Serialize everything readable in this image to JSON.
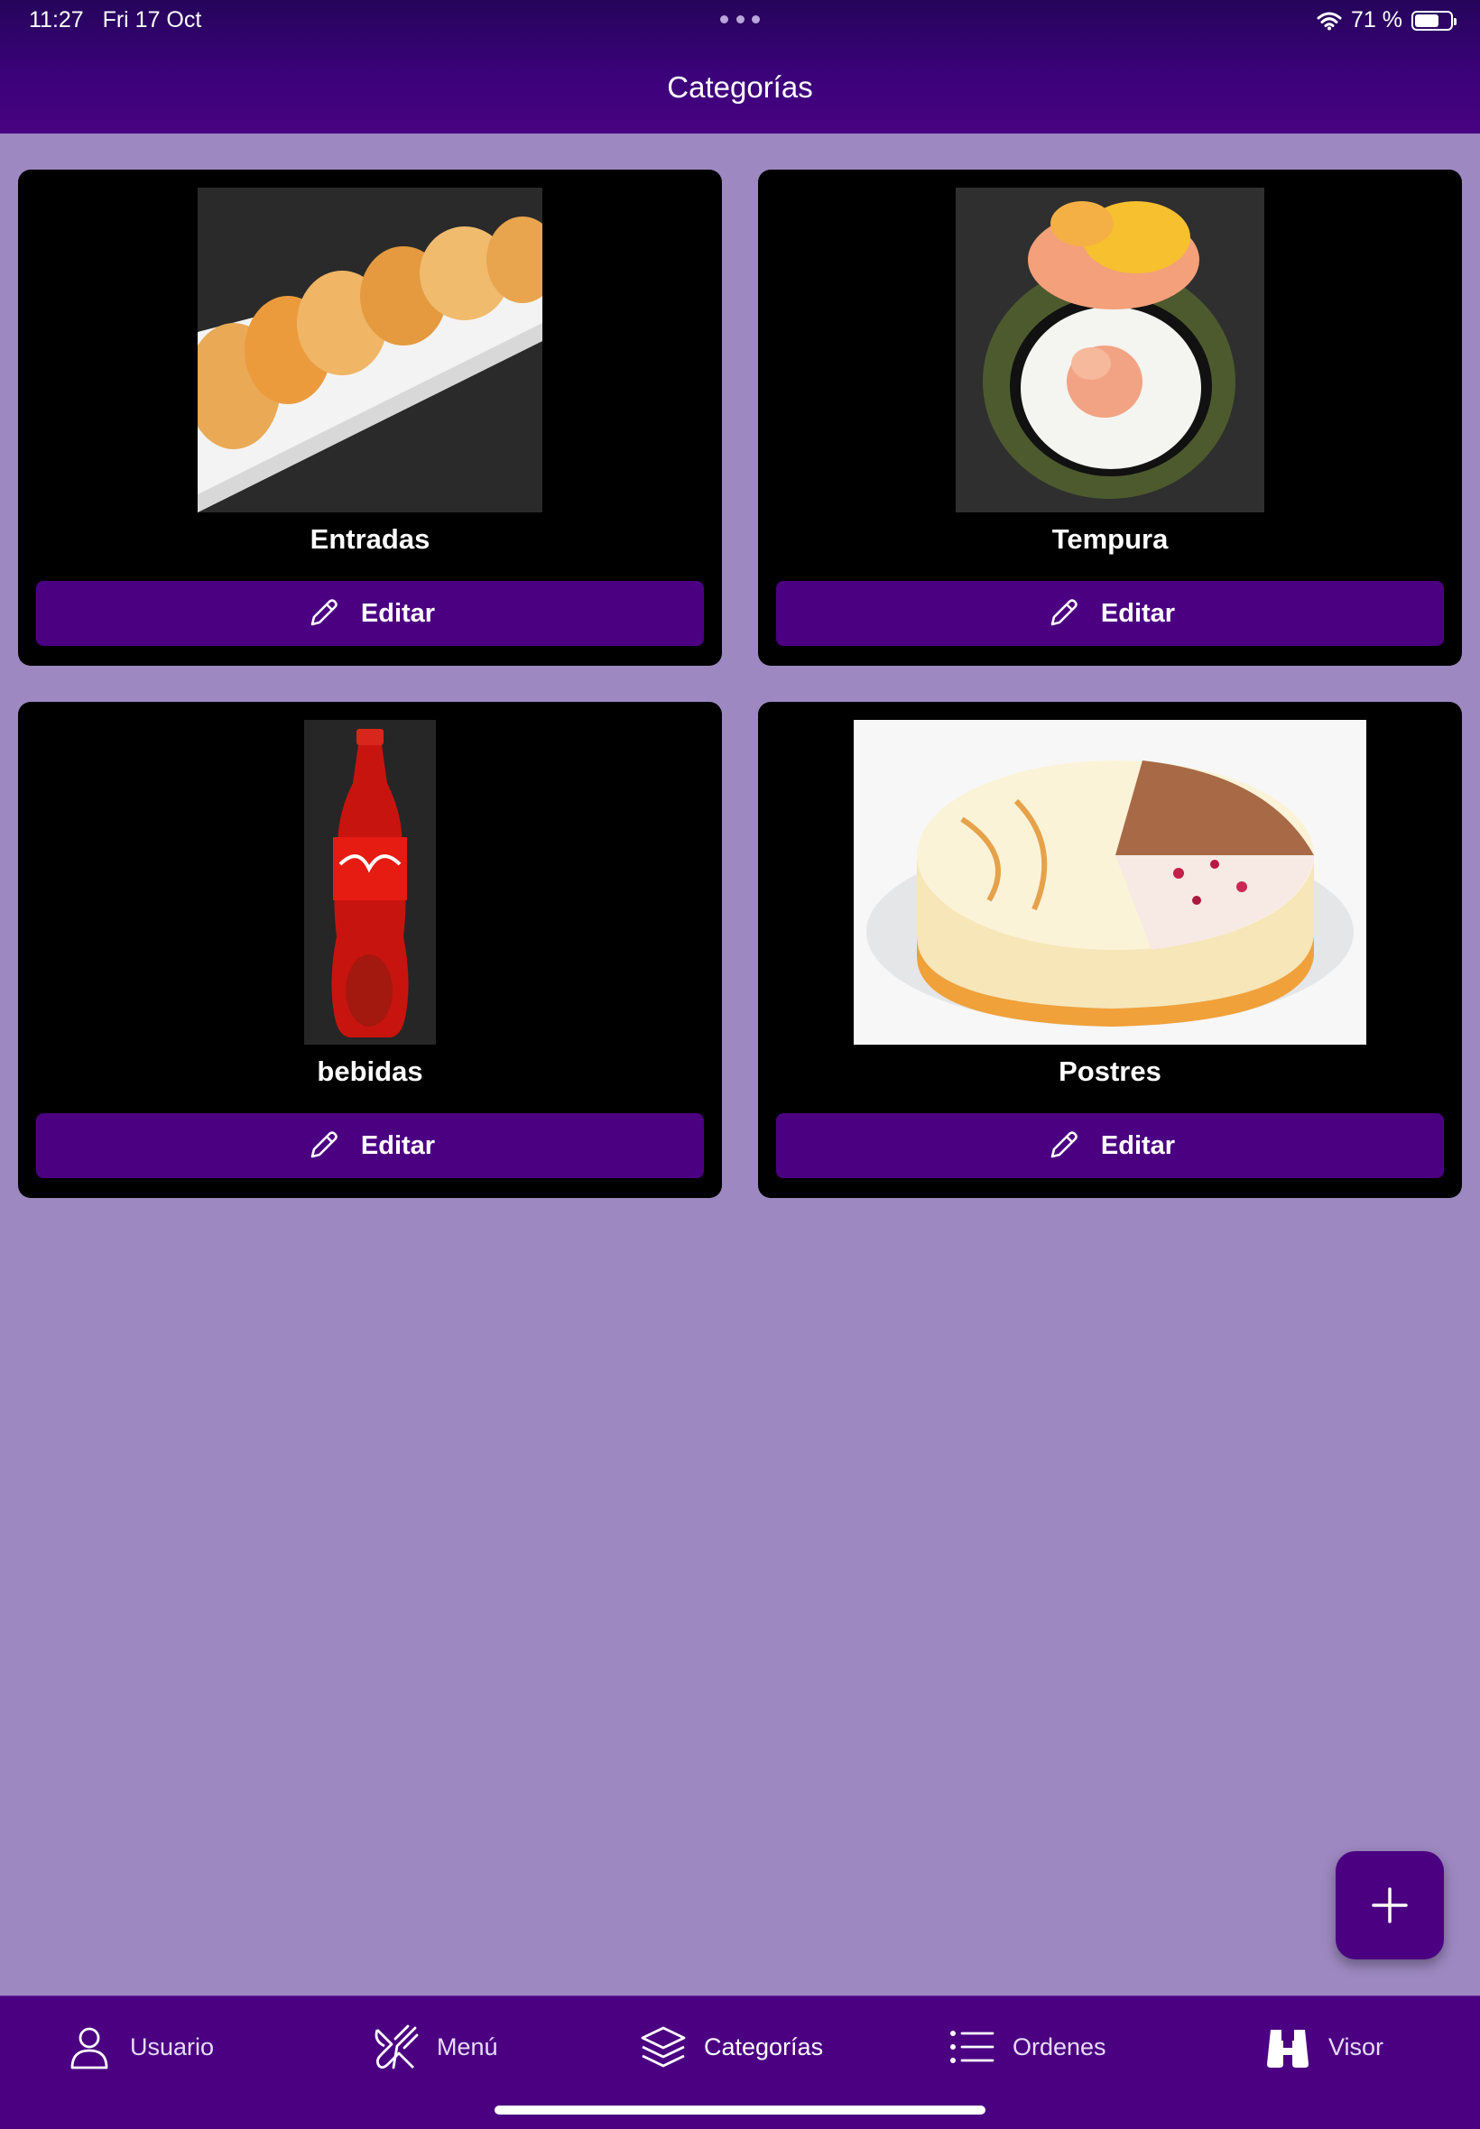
{
  "status_bar": {
    "time": "11:27",
    "date": "Fri 17 Oct",
    "battery": "71 %",
    "battery_level": 0.71,
    "icons": [
      "wifi-icon",
      "battery-icon",
      "more-dots-icon"
    ]
  },
  "header": {
    "title": "Categorías"
  },
  "categories": [
    {
      "name": "Entradas",
      "edit_label": "Editar",
      "image": "dumplings-photo"
    },
    {
      "name": "Tempura",
      "edit_label": "Editar",
      "image": "tempura-roll-photo"
    },
    {
      "name": "bebidas",
      "edit_label": "Editar",
      "image": "cola-bottle-photo"
    },
    {
      "name": "Postres",
      "edit_label": "Editar",
      "image": "cheesecake-photo"
    }
  ],
  "fab": {
    "icon": "plus-icon"
  },
  "tabs": [
    {
      "label": "Usuario",
      "icon": "user-icon",
      "active": false
    },
    {
      "label": "Menú",
      "icon": "utensils-icon",
      "active": false
    },
    {
      "label": "Categorías",
      "icon": "layers-icon",
      "active": true
    },
    {
      "label": "Ordenes",
      "icon": "list-icon",
      "active": false
    },
    {
      "label": "Visor",
      "icon": "binoculars-icon",
      "active": false
    }
  ],
  "colors": {
    "header": "#3b027a",
    "background": "#9d88c1",
    "accent": "#4b0082",
    "card": "#000000"
  }
}
